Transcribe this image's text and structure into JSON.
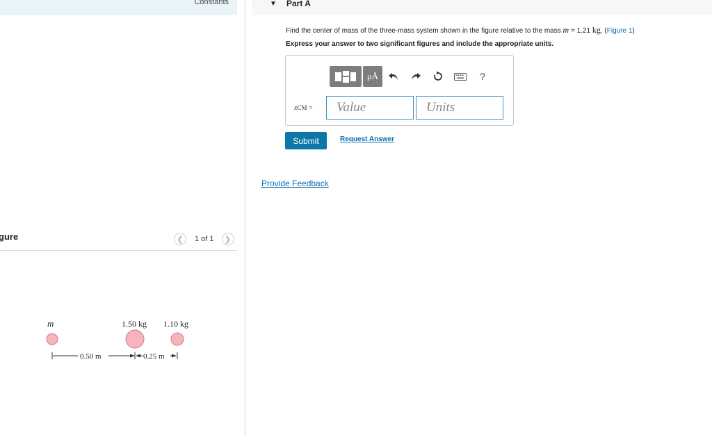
{
  "left_panel": {
    "constants_label": "Constants",
    "figure_heading": "gure",
    "pager": {
      "prev_icon": "chevron-left-icon",
      "next_icon": "chevron-right-icon",
      "text": "1 of 1"
    },
    "figure": {
      "mass_labels": [
        "m",
        "1.50 kg",
        "1.10 kg"
      ],
      "dimension_1": "0.50 m",
      "dimension_2": "0.25 m",
      "ball_color": "#f6b4bd",
      "ball_stroke": "#d07a86"
    }
  },
  "part": {
    "caret_icon": "caret-down-icon",
    "title": "Part A",
    "question_prefix": "Find the center of mass of the three-mass system shown in the figure relative to the mass",
    "question_var": "m",
    "question_equals": "= 1.21",
    "question_unit": "kg",
    "question_after": ". (",
    "figure_link": "Figure 1",
    "question_close": ")",
    "instruction": "Express your answer to two significant figures and include the appropriate units.",
    "answer": {
      "toolbar": {
        "templates_icon": "templates-icon",
        "units_label": "μÅ",
        "undo_icon": "undo-icon",
        "redo_icon": "redo-icon",
        "reset_icon": "reset-icon",
        "keyboard_icon": "keyboard-icon",
        "help_label": "?"
      },
      "label_var": "x",
      "label_sub": "CM",
      "label_equals": " =",
      "value_placeholder": "Value",
      "units_placeholder": "Units"
    },
    "submit_label": "Submit",
    "request_label": "Request Answer",
    "feedback_label": "Provide Feedback"
  },
  "colors": {
    "accent": "#0e77a8",
    "link": "#0a6db3",
    "field_border": "#3d8fbf"
  }
}
